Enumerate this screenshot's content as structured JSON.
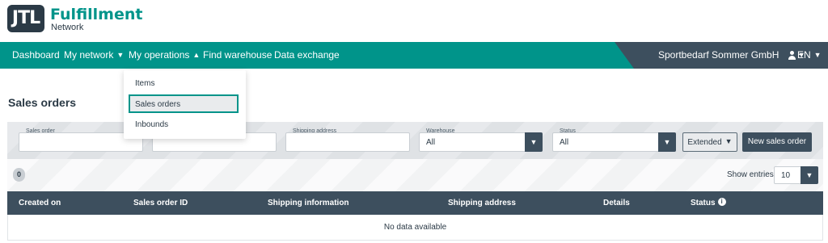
{
  "brand": {
    "logo_text": "JTL",
    "name": "Fulfillment",
    "sub": "Network"
  },
  "nav": {
    "items": [
      {
        "label": "Dashboard"
      },
      {
        "label": "My network"
      },
      {
        "label": "My operations"
      },
      {
        "label": "Find warehouse"
      },
      {
        "label": "Data exchange"
      }
    ],
    "company": "Sportbedarf Sommer GmbH",
    "language": "EN"
  },
  "dropdown": {
    "items": [
      "Items",
      "Sales orders",
      "Inbounds"
    ],
    "active": "Sales orders"
  },
  "page": {
    "title": "Sales orders"
  },
  "filters": {
    "sales_order": {
      "label": "Sales order",
      "value": ""
    },
    "customer": {
      "label": "",
      "value": ""
    },
    "shipping_address": {
      "label": "Shipping address",
      "value": ""
    },
    "warehouse": {
      "label": "Warehouse",
      "value": "All"
    },
    "status": {
      "label": "Status",
      "value": "All"
    },
    "extended_label": "Extended",
    "new_button_label": "New sales order"
  },
  "toolbar": {
    "count": "0",
    "show_entries_label": "Show entries",
    "entries_value": "10"
  },
  "table": {
    "columns": [
      "Created on",
      "Sales order ID",
      "Shipping information",
      "Shipping address",
      "Details",
      "Status"
    ],
    "empty_text": "No data available"
  },
  "colors": {
    "brand_teal": "#00948a",
    "dark_slate": "#3d4f5e"
  }
}
